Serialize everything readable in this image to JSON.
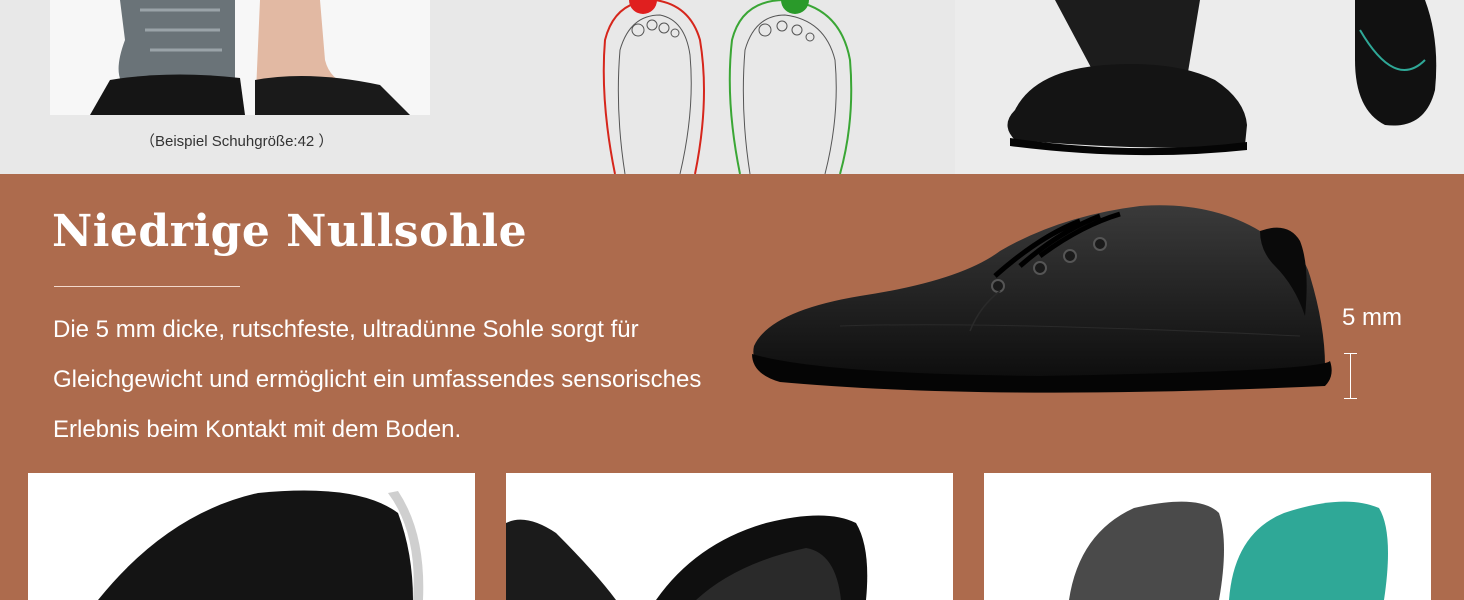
{
  "top": {
    "caption": "（Beispiel Schuhgröße:42 ）"
  },
  "feature": {
    "heading": "Niedrige Nullsohle",
    "description": "Die 5 mm dicke, rutschfeste, ultradünne Sohle sorgt für Gleichgewicht und ermöglicht ein umfassendes sensorisches Erlebnis beim Kontakt mit dem Boden.",
    "sole_label": "5 mm"
  },
  "colors": {
    "band": "#ad6b4d",
    "insole_teal": "#2fa897",
    "insole_grey": "#4a4a4a"
  }
}
